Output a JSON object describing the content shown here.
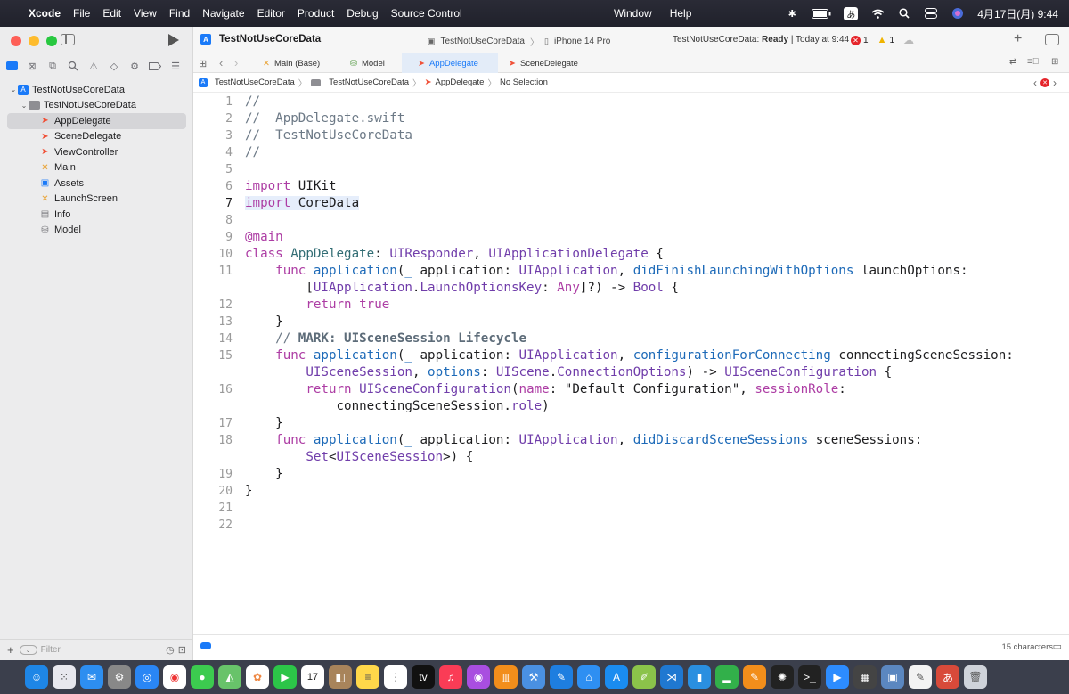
{
  "menubar": {
    "app_name": "Xcode",
    "menus": [
      "File",
      "Edit",
      "View",
      "Find",
      "Navigate",
      "Editor",
      "Product",
      "Debug",
      "Source Control"
    ],
    "menus_right": [
      "Window",
      "Help"
    ],
    "input_method": "あ",
    "clock": "4月17日(月) 9:44"
  },
  "toolbar": {
    "project_title": "TestNotUseCoreData",
    "scheme": "TestNotUseCoreData",
    "destination": "iPhone 14 Pro",
    "status_prefix": "TestNotUseCoreData: ",
    "status_state": "Ready",
    "status_suffix": " | Today at 9:44",
    "error_count": "1",
    "warning_count": "1"
  },
  "tabs": [
    {
      "label": "Main (Base)",
      "icon": "xib-icon",
      "active": false
    },
    {
      "label": "Model",
      "icon": "model-icon",
      "active": false
    },
    {
      "label": "AppDelegate",
      "icon": "swift-icon",
      "active": true
    },
    {
      "label": "SceneDelegate",
      "icon": "swift-icon",
      "active": false
    }
  ],
  "jumpbar": {
    "items": [
      "TestNotUseCoreData",
      "TestNotUseCoreData",
      "AppDelegate",
      "No Selection"
    ]
  },
  "navigator": {
    "items": [
      {
        "label": "TestNotUseCoreData",
        "icon": "project-icon",
        "level": 0,
        "disclosure": true
      },
      {
        "label": "TestNotUseCoreData",
        "icon": "folder-icon",
        "level": 1,
        "disclosure": true
      },
      {
        "label": "AppDelegate",
        "icon": "swift-icon",
        "level": 2,
        "selected": true
      },
      {
        "label": "SceneDelegate",
        "icon": "swift-icon",
        "level": 2
      },
      {
        "label": "ViewController",
        "icon": "swift-icon",
        "level": 2
      },
      {
        "label": "Main",
        "icon": "xib-icon",
        "level": 2
      },
      {
        "label": "Assets",
        "icon": "assets-icon",
        "level": 2
      },
      {
        "label": "LaunchScreen",
        "icon": "xib-icon",
        "level": 2
      },
      {
        "label": "Info",
        "icon": "plist-icon",
        "level": 2
      },
      {
        "label": "Model",
        "icon": "model-icon",
        "level": 2
      }
    ],
    "filter_placeholder": "Filter"
  },
  "editor": {
    "current_line": 7,
    "char_count": "15 characters"
  }
}
